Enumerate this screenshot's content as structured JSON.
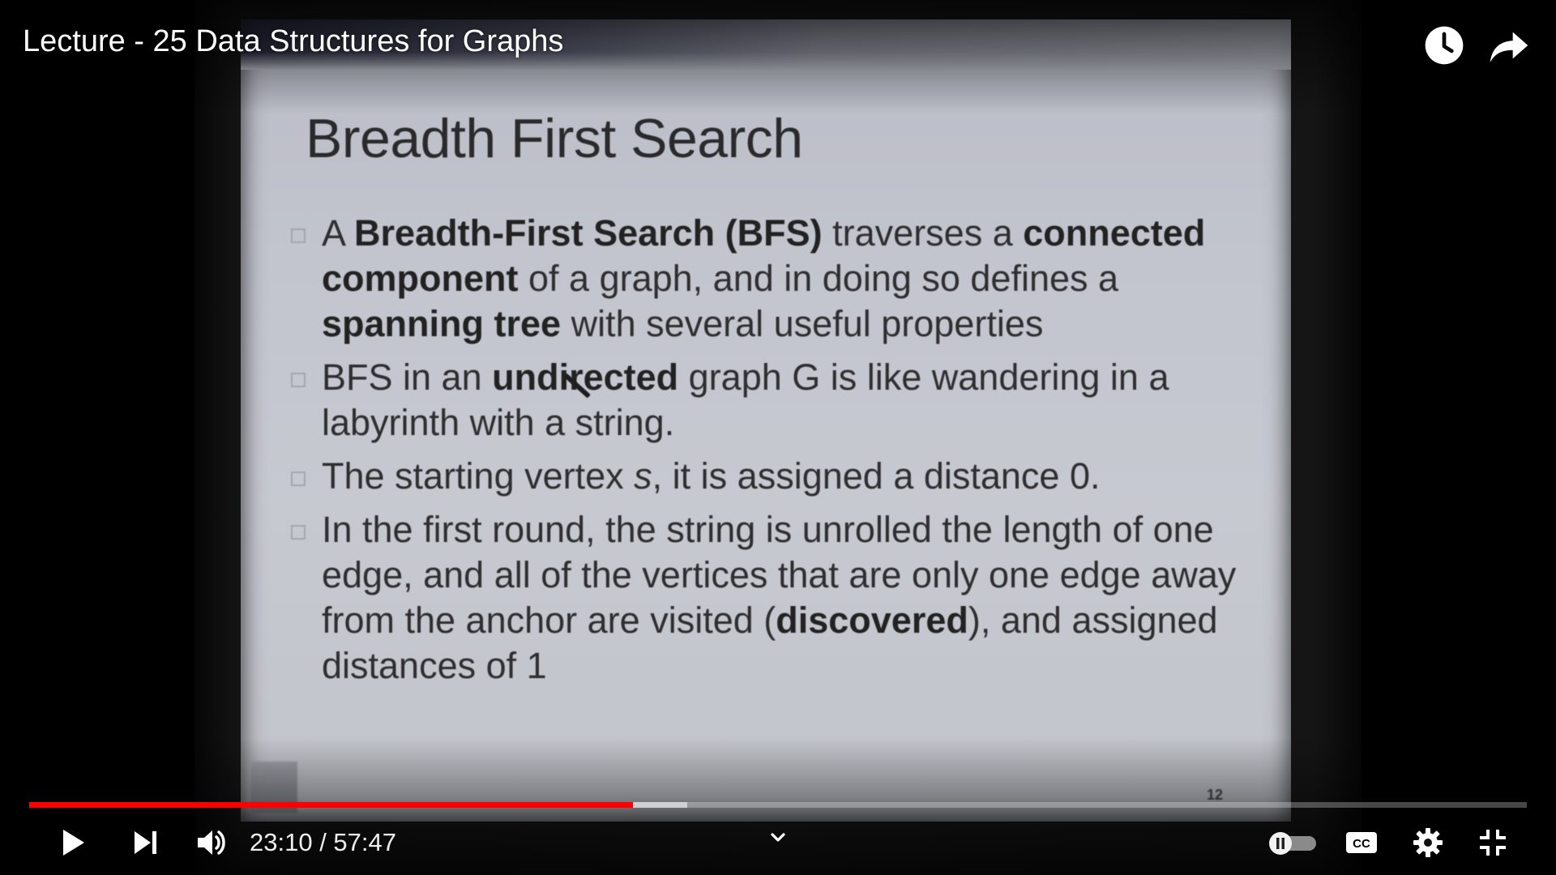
{
  "video": {
    "title": "Lecture - 25 Data Structures for Graphs"
  },
  "slide": {
    "title": "Breadth First Search",
    "bullets": [
      {
        "parts": [
          {
            "t": "A ",
            "b": false
          },
          {
            "t": "Breadth-First Search (BFS)",
            "b": true
          },
          {
            "t": " traverses a ",
            "b": false
          },
          {
            "t": "connected component",
            "b": true
          },
          {
            "t": " of a graph, and in doing so defines a ",
            "b": false
          },
          {
            "t": "spanning tree",
            "b": true
          },
          {
            "t": " with several useful properties",
            "b": false
          }
        ]
      },
      {
        "parts": [
          {
            "t": "BFS in an ",
            "b": false
          },
          {
            "t": "undirected",
            "b": true
          },
          {
            "t": " graph G is like wandering in a labyrinth with a string.",
            "b": false
          }
        ]
      },
      {
        "parts": [
          {
            "t": "The starting vertex ",
            "b": false
          },
          {
            "t": "s",
            "i": true
          },
          {
            "t": ", it is assigned a distance 0.",
            "b": false
          }
        ]
      },
      {
        "parts": [
          {
            "t": "In the first round, the string is unrolled the length of one edge, and all of the vertices that are only one edge away from the anchor are visited (",
            "b": false
          },
          {
            "t": "discovered",
            "b": true
          },
          {
            "t": "), and assigned distances of 1",
            "b": false
          }
        ]
      }
    ],
    "page_number": "12"
  },
  "controls": {
    "time_display": "23:10 / 57:47",
    "current_time": "23:10",
    "duration": "57:47",
    "progress_fraction": 0.4031,
    "buffer_fraction": 0.4396
  },
  "icons": {
    "watch_later": "clock-icon",
    "share": "share-arrow-icon",
    "play": "play-icon",
    "next": "next-track-icon",
    "volume": "volume-icon",
    "chapter": "chevron-down-icon",
    "autoplay": "autoplay-toggle-icon",
    "captions": "cc-icon",
    "settings": "gear-icon",
    "exit_fullscreen": "exit-fullscreen-icon"
  },
  "colors": {
    "progress_played": "#ff0000",
    "slide_background": "#c4c6ce",
    "text": "#ffffff"
  }
}
